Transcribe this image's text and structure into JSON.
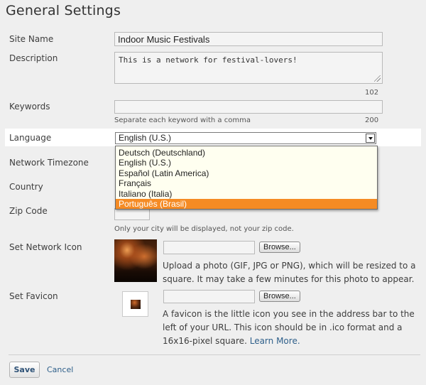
{
  "title": "General Settings",
  "site_name": {
    "label": "Site Name",
    "value": "Indoor Music Festivals"
  },
  "description": {
    "label": "Description",
    "value": "This is a network for festival-lovers!",
    "count": "102"
  },
  "keywords": {
    "label": "Keywords",
    "value": "",
    "help": "Separate each keyword with a comma",
    "count": "200"
  },
  "language": {
    "label": "Language",
    "selected": "English (U.S.)",
    "options": [
      "Deutsch (Deutschland)",
      "English (U.S.)",
      "Español (Latin America)",
      "Français",
      "Italiano (Italia)",
      "Português (Brasil)"
    ],
    "highlighted_index": 5
  },
  "timezone": {
    "label": "Network Timezone"
  },
  "country": {
    "label": "Country"
  },
  "zip": {
    "label": "Zip Code",
    "help": "Only your city will be displayed, not your zip code."
  },
  "network_icon": {
    "label": "Set Network Icon",
    "browse": "Browse...",
    "help": "Upload a photo (GIF, JPG or PNG), which will be resized to a square. It may take a few minutes for this photo to appear."
  },
  "favicon": {
    "label": "Set Favicon",
    "browse": "Browse...",
    "help": "A favicon is the little icon you see in the address bar to the left of your URL. This icon should be in .ico format and a 16x16-pixel square.",
    "learn_more": "Learn More."
  },
  "actions": {
    "save": "Save",
    "cancel": "Cancel"
  },
  "colors": {
    "highlight": "#f58b24",
    "link": "#2e5f8a",
    "background": "#efefef"
  }
}
